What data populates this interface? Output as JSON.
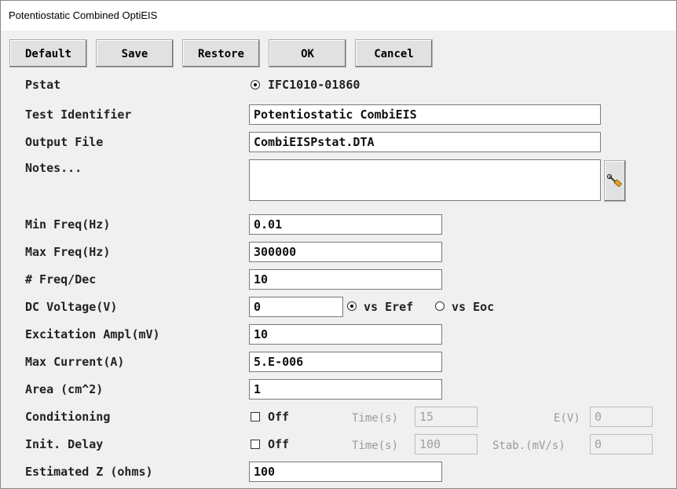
{
  "window": {
    "title": "Potentiostatic Combined OptiEIS"
  },
  "toolbar": {
    "default_label": "Default",
    "save_label": "Save",
    "restore_label": "Restore",
    "ok_label": "OK",
    "cancel_label": "Cancel"
  },
  "form": {
    "pstat": {
      "label": "Pstat",
      "option": "IFC1010-01860",
      "selected": true
    },
    "test_identifier": {
      "label": "Test Identifier",
      "value": "Potentiostatic CombiEIS"
    },
    "output_file": {
      "label": "Output File",
      "value": "CombiEISPstat.DTA"
    },
    "notes": {
      "label": "Notes...",
      "value": "",
      "button_icon": "edit-pen-icon"
    },
    "min_freq": {
      "label": "Min Freq(Hz)",
      "value": "0.01"
    },
    "max_freq": {
      "label": "Max Freq(Hz)",
      "value": "300000"
    },
    "freq_dec": {
      "label": "# Freq/Dec",
      "value": "10"
    },
    "dc_voltage": {
      "label": "DC Voltage(V)",
      "value": "0",
      "ref_options": [
        "vs Eref",
        "vs Eoc"
      ],
      "selected_ref": "vs Eref"
    },
    "excitation": {
      "label": "Excitation Ampl(mV)",
      "value": "10"
    },
    "max_current": {
      "label": "Max Current(A)",
      "value": "5.E-006"
    },
    "area": {
      "label": "Area (cm^2)",
      "value": "1"
    },
    "conditioning": {
      "label": "Conditioning",
      "checkbox_label": "Off",
      "checked": false,
      "time_label": "Time(s)",
      "time_value": "15",
      "e_label": "E(V)",
      "e_value": "0"
    },
    "init_delay": {
      "label": "Init. Delay",
      "checkbox_label": "Off",
      "checked": false,
      "time_label": "Time(s)",
      "time_value": "100",
      "stab_label": "Stab.(mV/s)",
      "stab_value": "0"
    },
    "estimated_z": {
      "label": "Estimated Z (ohms)",
      "value": "100"
    }
  }
}
